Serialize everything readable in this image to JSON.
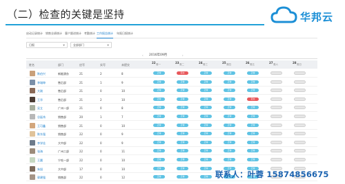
{
  "slide": {
    "title": "（二）检查的关键是坚持"
  },
  "brand": {
    "name": "华邦云",
    "color": "#1c8fd6"
  },
  "tabs": [
    {
      "label": "启动记录统计",
      "active": false
    },
    {
      "label": "销售业绩统计",
      "active": false
    },
    {
      "label": "客户跟进统计",
      "active": false
    },
    {
      "label": "考勤统计",
      "active": false
    },
    {
      "label": "工作报告统计",
      "active": true
    },
    {
      "label": "年报日报统计",
      "active": false
    }
  ],
  "filters": {
    "period": "日报",
    "department": "全部部门"
  },
  "date_nav": {
    "prev": "‹",
    "label": "2016年09月",
    "next": "›"
  },
  "table": {
    "columns": [
      "姓名",
      "部门",
      "应写",
      "实写",
      "未提交"
    ],
    "days": [
      {
        "num": "22",
        "week": "周一"
      },
      {
        "num": "23",
        "week": "周二"
      },
      {
        "num": "24",
        "week": "周三"
      },
      {
        "num": "25",
        "week": "周四"
      },
      {
        "num": "26",
        "week": "周五"
      },
      {
        "num": "27",
        "week": "周六"
      },
      {
        "num": "28",
        "week": "周日"
      }
    ],
    "status_labels": {
      "ok": "正常",
      "late": "迟交",
      "none": ""
    },
    "rows": [
      {
        "name": "陈伯兴",
        "dept": "新能源办",
        "should": "21",
        "wrote": "2",
        "missing": "8",
        "status": [
          "ok",
          "late",
          "ok",
          "ok",
          "ok",
          "none",
          "none"
        ],
        "avatar": "#c9a07a"
      },
      {
        "name": "李瑞坤",
        "dept": "售后部",
        "should": "21",
        "wrote": "1",
        "missing": "9",
        "status": [
          "ok",
          "ok",
          "ok",
          "ok",
          "ok",
          "none",
          "none"
        ],
        "avatar": "#7a8fa8"
      },
      {
        "name": "大刚",
        "dept": "售后部",
        "should": "21",
        "wrote": "0",
        "missing": "10",
        "status": [
          "ok",
          "ok",
          "ok",
          "ok",
          "ok",
          "none",
          "none"
        ],
        "avatar": "#8a6a58"
      },
      {
        "name": "王华",
        "dept": "售后部",
        "should": "21",
        "wrote": "2",
        "missing": "10",
        "status": [
          "ok",
          "ok",
          "ok",
          "ok",
          "late",
          "none",
          "none"
        ],
        "avatar": "#4b3d36"
      },
      {
        "name": "吴立",
        "dept": "广州一部",
        "should": "21",
        "wrote": "0",
        "missing": "8",
        "status": [
          "ok",
          "ok",
          "ok",
          "ok",
          "ok",
          "none",
          "none"
        ],
        "avatar": "#a8b0a0"
      },
      {
        "name": "谷延伟",
        "dept": "销售部",
        "should": "20",
        "wrote": "1",
        "missing": "7",
        "status": [
          "ok",
          "ok",
          "ok",
          "ok",
          "ok",
          "none",
          "none"
        ],
        "avatar": "#b8b8b8"
      },
      {
        "name": "王可鑫",
        "dept": "销售部",
        "should": "21",
        "wrote": "0",
        "missing": "10",
        "status": [
          "ok",
          "ok",
          "ok",
          "ok",
          "ok",
          "none",
          "none"
        ],
        "avatar": "#d2a67c"
      },
      {
        "name": "陈东强",
        "dept": "销售部",
        "should": "22",
        "wrote": "0",
        "missing": "9",
        "status": [
          "ok",
          "ok",
          "ok",
          "ok",
          "ok",
          "none",
          "none"
        ],
        "avatar": "#e0c39a"
      },
      {
        "name": "李学佳",
        "dept": "大中部",
        "should": "22",
        "wrote": "0",
        "missing": "9",
        "status": [
          "ok",
          "ok",
          "ok",
          "ok",
          "ok",
          "none",
          "none"
        ],
        "avatar": "#6d7b8a"
      },
      {
        "name": "张海",
        "dept": "广州二部",
        "should": "22",
        "wrote": "0",
        "missing": "11",
        "status": [
          "ok",
          "ok",
          "ok",
          "ok",
          "ok",
          "none",
          "none"
        ],
        "avatar": "#9b8b7a"
      },
      {
        "name": "王晨",
        "dept": "宁吃一部",
        "should": "22",
        "wrote": "0",
        "missing": "10",
        "status": [
          "ok",
          "ok",
          "ok",
          "ok",
          "ok",
          "none",
          "none"
        ],
        "avatar": "#c6d8c2"
      },
      {
        "name": "朱旭",
        "dept": "大中部",
        "should": "17",
        "wrote": "0",
        "missing": "10",
        "status": [
          "ok",
          "ok",
          "ok",
          "ok",
          "ok",
          "none",
          "none"
        ],
        "avatar": "#7d6b5c"
      },
      {
        "name": "郭建强",
        "dept": "销售部",
        "should": "22",
        "wrote": "0",
        "missing": "12",
        "status": [
          "ok",
          "ok",
          "ok",
          "ok",
          "ok",
          "none",
          "none"
        ],
        "avatar": "#a59486"
      }
    ]
  },
  "contact": "联系人：叶蓉 15874856675"
}
